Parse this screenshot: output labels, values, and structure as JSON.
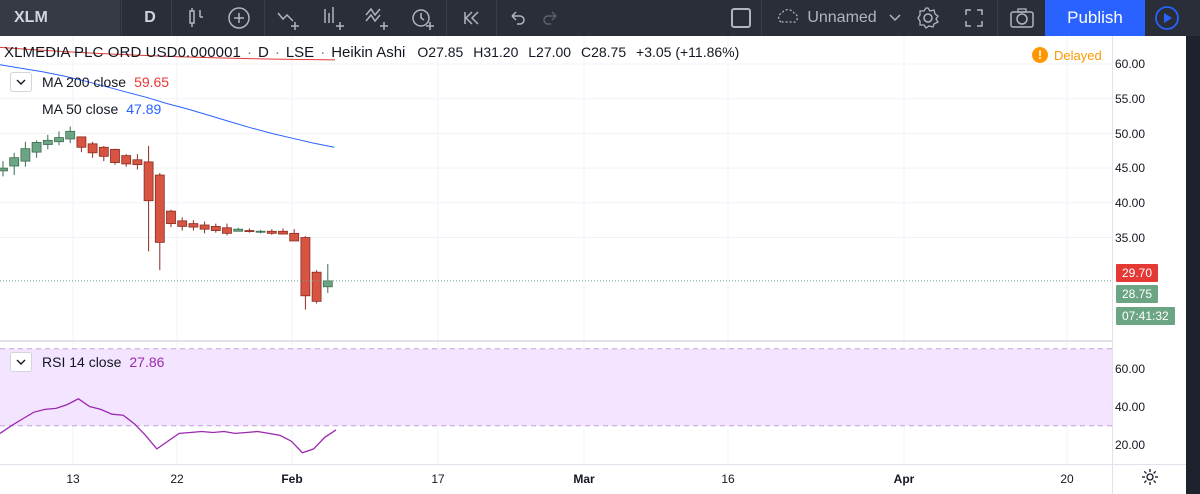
{
  "toolbar": {
    "symbol": "XLM",
    "interval": "D",
    "layout_name": "Unnamed",
    "publish_label": "Publish",
    "icons": [
      "bar-style-icon",
      "add-compare-icon",
      "indicators-icon",
      "financials-icon",
      "templates-icon",
      "alert-icon",
      "replay-icon",
      "undo-icon",
      "redo-icon",
      "layout-checkbox-icon",
      "cloud-icon",
      "chevron-down-icon",
      "settings-icon",
      "fullscreen-icon",
      "camera-icon",
      "play-icon"
    ]
  },
  "legend": {
    "title": "XLMEDIA PLC ORD USD0.000001",
    "interval": "D",
    "exchange": "LSE",
    "chart_type": "Heikin Ashi",
    "open": "O27.85",
    "high": "H31.20",
    "low": "L27.00",
    "close": "C28.75",
    "change": "+3.05 (+11.86%)",
    "separator": "·"
  },
  "indicators": {
    "ma200": {
      "label": "MA 200 close",
      "value": "59.65",
      "color": "#e53935"
    },
    "ma50": {
      "label": "MA 50 close",
      "value": "47.89",
      "color": "#2962ff"
    },
    "rsi": {
      "label": "RSI 14 close",
      "value": "27.86",
      "color": "#9c27b0"
    }
  },
  "status": {
    "delayed_label": "Delayed",
    "warn_glyph": "!"
  },
  "price_axis": {
    "main_ticks": [
      "60.00",
      "55.00",
      "50.00",
      "45.00",
      "40.00",
      "35.00"
    ],
    "rsi_ticks": [
      "60.00",
      "40.00",
      "20.00"
    ],
    "ma_badge": "29.70",
    "last_price_badge": "28.75",
    "countdown_badge": "07:41:32"
  },
  "time_axis": {
    "labels": [
      "13",
      "22",
      "Feb",
      "17",
      "Mar",
      "16",
      "Apr",
      "20"
    ]
  },
  "colors": {
    "up": "#6ba583",
    "down": "#d75442",
    "ma50": "#2962ff",
    "ma200": "#e53935",
    "rsi": "#9c27b0",
    "rsi_band": "#f3e5ff",
    "publish": "#2962ff",
    "delayed": "#ff9800"
  },
  "chart_data": {
    "type": "candlestick",
    "series_name": "Heikin Ashi",
    "candles": [
      {
        "o": 44.6,
        "h": 46.0,
        "l": 43.8,
        "c": 45.0
      },
      {
        "o": 45.3,
        "h": 47.2,
        "l": 44.0,
        "c": 46.5
      },
      {
        "o": 46.0,
        "h": 48.8,
        "l": 45.2,
        "c": 47.8
      },
      {
        "o": 47.3,
        "h": 49.0,
        "l": 46.5,
        "c": 48.7
      },
      {
        "o": 48.4,
        "h": 49.8,
        "l": 47.7,
        "c": 49.0
      },
      {
        "o": 48.8,
        "h": 50.3,
        "l": 48.3,
        "c": 49.4
      },
      {
        "o": 49.2,
        "h": 51.0,
        "l": 48.6,
        "c": 50.3
      },
      {
        "o": 49.5,
        "h": 49.5,
        "l": 47.3,
        "c": 48.0
      },
      {
        "o": 48.5,
        "h": 48.8,
        "l": 46.5,
        "c": 47.2
      },
      {
        "o": 48.0,
        "h": 48.2,
        "l": 46.0,
        "c": 46.7
      },
      {
        "o": 47.7,
        "h": 47.8,
        "l": 45.5,
        "c": 45.8
      },
      {
        "o": 46.8,
        "h": 47.0,
        "l": 45.2,
        "c": 45.6
      },
      {
        "o": 46.2,
        "h": 47.0,
        "l": 44.8,
        "c": 45.5
      },
      {
        "o": 45.9,
        "h": 48.2,
        "l": 33.0,
        "c": 40.3
      },
      {
        "o": 44.0,
        "h": 44.3,
        "l": 30.3,
        "c": 34.3
      },
      {
        "o": 38.8,
        "h": 39.0,
        "l": 36.5,
        "c": 37.0
      },
      {
        "o": 37.4,
        "h": 37.9,
        "l": 36.0,
        "c": 36.6
      },
      {
        "o": 37.0,
        "h": 37.5,
        "l": 36.0,
        "c": 36.5
      },
      {
        "o": 36.8,
        "h": 37.3,
        "l": 35.6,
        "c": 36.2
      },
      {
        "o": 36.6,
        "h": 37.0,
        "l": 35.7,
        "c": 36.0
      },
      {
        "o": 36.4,
        "h": 37.0,
        "l": 35.3,
        "c": 35.6
      },
      {
        "o": 35.9,
        "h": 36.4,
        "l": 35.9,
        "c": 36.2
      },
      {
        "o": 36.0,
        "h": 36.3,
        "l": 35.7,
        "c": 35.9
      },
      {
        "o": 35.8,
        "h": 36.1,
        "l": 35.6,
        "c": 35.9
      },
      {
        "o": 35.9,
        "h": 36.2,
        "l": 35.4,
        "c": 35.6
      },
      {
        "o": 35.9,
        "h": 36.3,
        "l": 35.5,
        "c": 35.5
      },
      {
        "o": 35.6,
        "h": 36.2,
        "l": 34.6,
        "c": 34.5
      },
      {
        "o": 35.0,
        "h": 35.2,
        "l": 24.6,
        "c": 26.6
      },
      {
        "o": 30.0,
        "h": 30.3,
        "l": 25.5,
        "c": 25.8
      },
      {
        "o": 27.9,
        "h": 31.2,
        "l": 27.0,
        "c": 28.75
      }
    ],
    "ma50": [
      59.9,
      59.4,
      58.9,
      58.3,
      57.6,
      56.8,
      56.0,
      55.2,
      54.3,
      53.5,
      52.6,
      51.7,
      50.8,
      50.0,
      49.3,
      48.6,
      48.0
    ],
    "rsi": [
      26,
      30,
      33.5,
      37,
      38.5,
      39,
      41,
      44,
      40,
      38.5,
      36,
      35.5,
      31,
      25,
      18,
      22,
      26,
      26.5,
      27,
      26.5,
      27,
      26,
      26.5,
      27,
      26,
      25,
      22,
      16,
      18,
      24,
      27.86
    ],
    "ylim": [
      22,
      63
    ],
    "rsi_ylim": [
      15,
      70
    ],
    "rsi_levels": [
      30,
      70
    ],
    "last_price": 28.75
  }
}
